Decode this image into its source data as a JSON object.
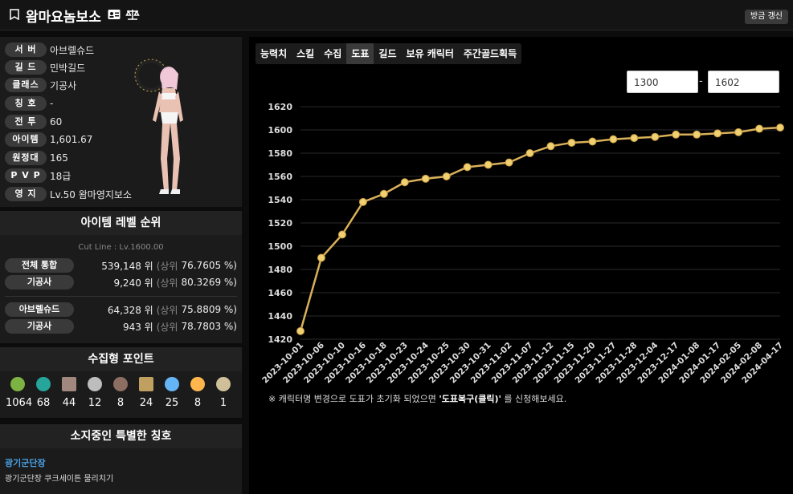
{
  "header": {
    "title": "왐마요놈보소",
    "refresh_label": "방금 갱신"
  },
  "profile": {
    "rows": [
      {
        "label": "서 버",
        "value": "아브렐슈드"
      },
      {
        "label": "길 드",
        "value": "민박길드"
      },
      {
        "label": "클래스",
        "value": "기공사"
      },
      {
        "label": "칭 호",
        "value": "-"
      },
      {
        "label": "전 투",
        "value": "60"
      },
      {
        "label": "아이템",
        "value": "1,601.67"
      },
      {
        "label": "원정대",
        "value": "165"
      },
      {
        "label": "P V P",
        "value": "18급"
      },
      {
        "label": "영 지",
        "value": "Lv.50 왐마영지보소"
      }
    ]
  },
  "ranking": {
    "title": "아이템 레벨 순위",
    "cutline": "Cut Line : Lv.1600.00",
    "rows": [
      {
        "label": "전체 통합",
        "rank": "539,148 위",
        "mid": "(상위",
        "pct": "76.7605 %)"
      },
      {
        "label": "기공사",
        "rank": "9,240 위",
        "mid": "(상위",
        "pct": "80.3269 %)"
      },
      {
        "label": "아브렐슈드",
        "rank": "64,328 위",
        "mid": "(상위",
        "pct": "75.8809 %)"
      },
      {
        "label": "기공사",
        "rank": "943 위",
        "mid": "(상위",
        "pct": "78.7803 %)"
      }
    ]
  },
  "collection": {
    "title": "수집형 포인트",
    "items": [
      {
        "icon": "seed-icon",
        "color": "#7cb342",
        "value": "1064"
      },
      {
        "icon": "island-icon",
        "color": "#26a69a",
        "value": "68"
      },
      {
        "icon": "map-icon",
        "color": "#a1887f",
        "value": "44"
      },
      {
        "icon": "heart-icon",
        "color": "#bdbdbd",
        "value": "12"
      },
      {
        "icon": "mask-icon",
        "color": "#8d6e63",
        "value": "8"
      },
      {
        "icon": "leaf-icon",
        "color": "#c0a060",
        "value": "24"
      },
      {
        "icon": "star-icon",
        "color": "#64b5f6",
        "value": "25"
      },
      {
        "icon": "sun-icon",
        "color": "#ffb74d",
        "value": "8"
      },
      {
        "icon": "orb-icon",
        "color": "#cfc09a",
        "value": "1"
      }
    ]
  },
  "titles": {
    "title": "소지중인 특별한 칭호",
    "name": "광기군단장",
    "desc": "광기군단장 쿠크세이튼 물리치기"
  },
  "tabs": [
    "능력치",
    "스킬",
    "수집",
    "도표",
    "길드",
    "보유 캐릭터",
    "주간골드획득"
  ],
  "active_tab": 3,
  "range": {
    "from": "1300",
    "to": "1602",
    "sep": "-"
  },
  "note": {
    "prefix": "※ 캐릭터명 변경으로 도표가 초기화 되었으면 ",
    "link": "'도표복구(클릭)'",
    "suffix": " 를 신청해보세요."
  },
  "colors": {
    "line": "#d9b05a",
    "point": "#f0d070",
    "bg": "#000000"
  },
  "chart_data": {
    "type": "line",
    "x": [
      "2023-10-01",
      "2023-10-06",
      "2023-10-10",
      "2023-10-16",
      "2023-10-18",
      "2023-10-23",
      "2023-10-24",
      "2023-10-25",
      "2023-10-30",
      "2023-10-31",
      "2023-11-02",
      "2023-11-07",
      "2023-11-12",
      "2023-11-15",
      "2023-11-20",
      "2023-11-27",
      "2023-11-28",
      "2023-12-04",
      "2023-12-17",
      "2024-01-08",
      "2024-01-17",
      "2024-02-05",
      "2024-02-08",
      "2024-04-17"
    ],
    "values": [
      1427,
      1490,
      1510,
      1538,
      1545,
      1555,
      1558,
      1560,
      1568,
      1570,
      1572,
      1580,
      1586,
      1589,
      1590,
      1592,
      1593,
      1594,
      1596,
      1596,
      1597,
      1598,
      1601,
      1602
    ],
    "ylim": [
      1420,
      1620
    ],
    "yticks": [
      1420,
      1440,
      1460,
      1480,
      1500,
      1520,
      1540,
      1560,
      1580,
      1600,
      1620
    ],
    "grid": true
  }
}
